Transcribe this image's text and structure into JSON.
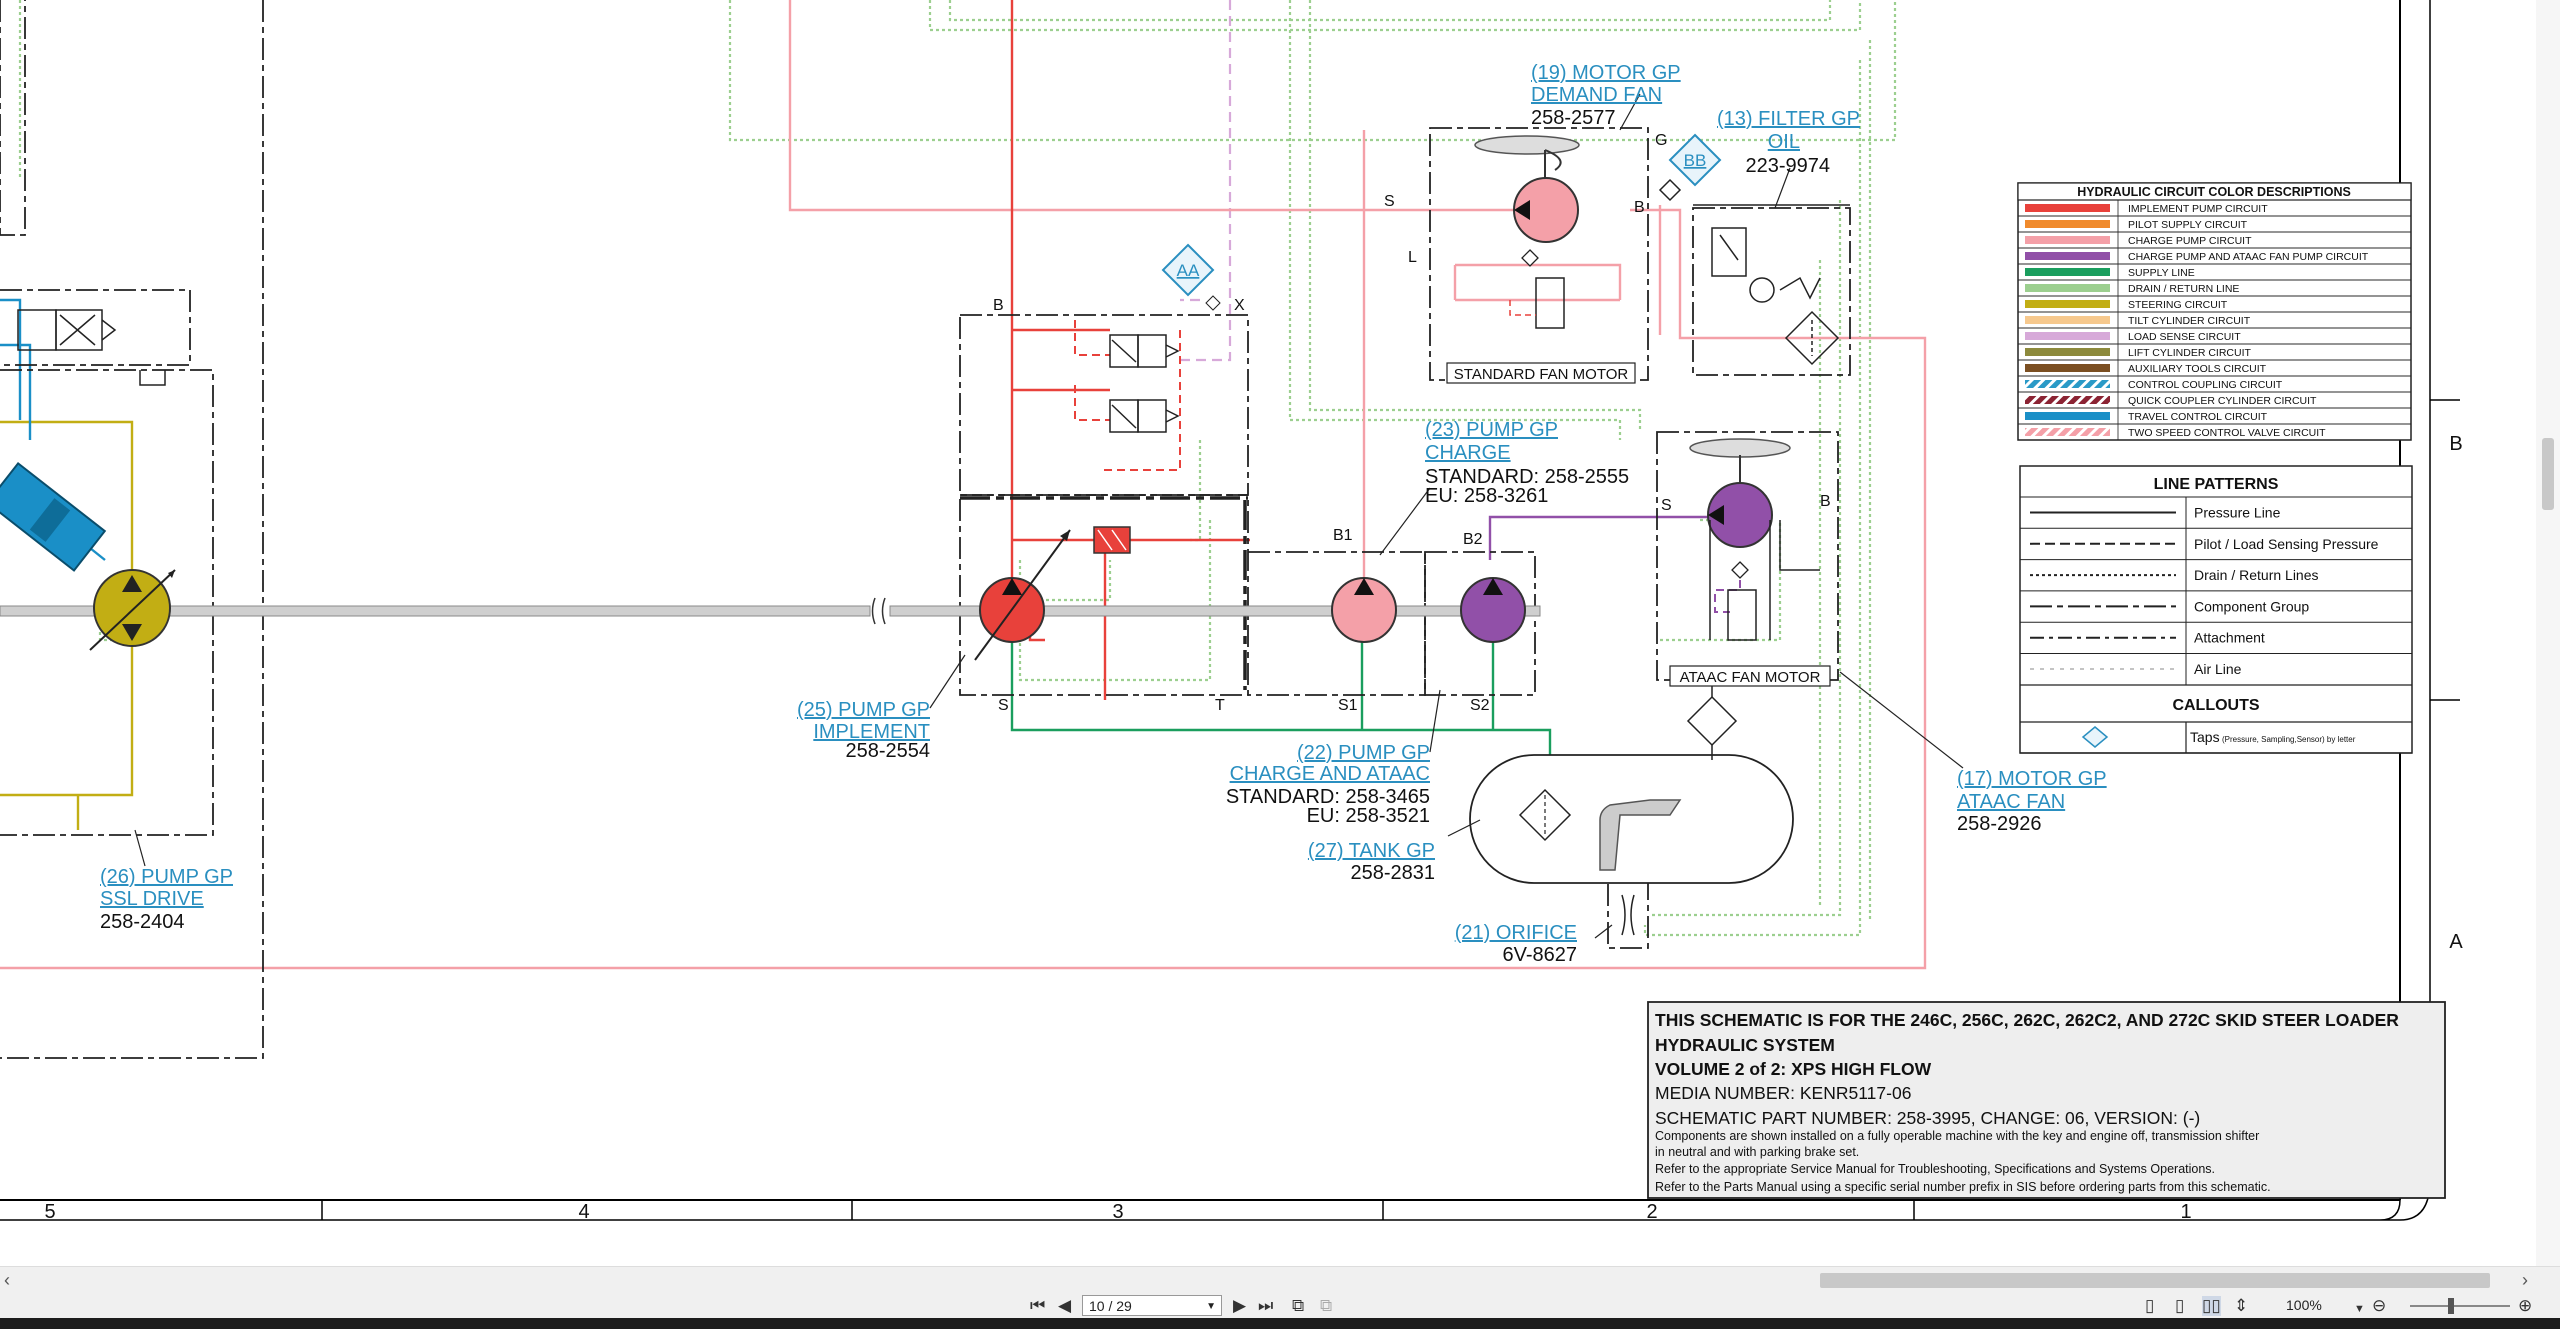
{
  "callouts": {
    "motor_demand_fan": {
      "title1": "(19) MOTOR GP",
      "title2": "DEMAND FAN",
      "part": "258-2577"
    },
    "filter_oil": {
      "title1": "(13) FILTER GP",
      "title2": "OIL",
      "part": "223-9974"
    },
    "pump_charge": {
      "title1": "(23) PUMP GP",
      "title2": "CHARGE",
      "part1": "STANDARD: 258-2555",
      "part2": "EU: 258-3261"
    },
    "pump_implement": {
      "title1": "(25) PUMP GP",
      "title2": "IMPLEMENT",
      "part": "258-2554"
    },
    "pump_charge_ataac": {
      "title1": "(22) PUMP GP",
      "title2": "CHARGE AND ATAAC",
      "part1": "STANDARD: 258-3465",
      "part2": "EU: 258-3521"
    },
    "tank": {
      "title1": "(27) TANK GP",
      "part": "258-2831"
    },
    "orifice": {
      "title1": "(21) ORIFICE",
      "part": "6V-8627"
    },
    "pump_ssl": {
      "title1": "(26) PUMP GP",
      "title2": "SSL DRIVE",
      "part": "258-2404"
    },
    "motor_ataac": {
      "title1": "(17) MOTOR GP",
      "title2": "ATAAC FAN",
      "part": "258-2926"
    }
  },
  "component_labels": {
    "standard_fan_motor": "STANDARD FAN MOTOR",
    "ataac_fan_motor": "ATAAC FAN MOTOR",
    "tap_aa": "AA",
    "tap_bb": "BB",
    "ports": {
      "s_fan": "S",
      "b_fan": "B",
      "l_fan": "L",
      "g": "G",
      "b_valve": "B",
      "x": "X",
      "b1": "B1",
      "b2": "B2",
      "s_pump": "S",
      "t": "T",
      "s1": "S1",
      "s2": "S2",
      "s_ataac": "S",
      "b_ataac": "B"
    }
  },
  "color_legend": {
    "title": "HYDRAULIC CIRCUIT COLOR DESCRIPTIONS",
    "items": [
      {
        "label": "IMPLEMENT PUMP CIRCUIT",
        "color": "#e8413b"
      },
      {
        "label": "PILOT SUPPLY CIRCUIT",
        "color": "#f08a2c"
      },
      {
        "label": "CHARGE PUMP CIRCUIT",
        "color": "#f4a0a8"
      },
      {
        "label": "CHARGE PUMP AND ATAAC FAN PUMP CIRCUIT",
        "color": "#9150a8"
      },
      {
        "label": "SUPPLY LINE",
        "color": "#1a9e5e"
      },
      {
        "label": "DRAIN / RETURN LINE",
        "color": "#9ccf8f"
      },
      {
        "label": "STEERING CIRCUIT",
        "color": "#c2ae14"
      },
      {
        "label": "TILT CYLINDER CIRCUIT",
        "color": "#f7c98e"
      },
      {
        "label": "LOAD SENSE CIRCUIT",
        "color": "#d7a9d9"
      },
      {
        "label": "LIFT CYLINDER CIRCUIT",
        "color": "#8d8a3c"
      },
      {
        "label": "AUXILIARY TOOLS CIRCUIT",
        "color": "#7b4f22"
      },
      {
        "label": "CONTROL COUPLING CIRCUIT",
        "color": "#2a9ac7",
        "hatch": "#ffffff"
      },
      {
        "label": "QUICK COUPLER CYLINDER CIRCUIT",
        "color": "#8b2333",
        "hatch": "#ffffff"
      },
      {
        "label": "TRAVEL CONTROL CIRCUIT",
        "color": "#1a8fc7"
      },
      {
        "label": "TWO SPEED CONTROL VALVE CIRCUIT",
        "color": "#f4a0a8",
        "hatch": "#ffffff"
      }
    ]
  },
  "line_patterns": {
    "title": "LINE PATTERNS",
    "items": [
      {
        "label": "Pressure Line",
        "dash": ""
      },
      {
        "label": "Pilot / Load Sensing Pressure",
        "dash": "10 5"
      },
      {
        "label": "Drain / Return Lines",
        "dash": "3 3"
      },
      {
        "label": "Component Group",
        "dash": "22 5 6 5"
      },
      {
        "label": "Attachment",
        "dash": "14 5 4 5"
      },
      {
        "label": "Air Line",
        "dash": "4 6"
      }
    ],
    "callouts_title": "CALLOUTS",
    "taps_label": "Taps",
    "taps_note": "(Pressure, Sampling,Sensor) by letter"
  },
  "title_block": {
    "line1": "THIS SCHEMATIC IS FOR THE 246C, 256C, 262C, 262C2, AND 272C SKID STEER LOADER",
    "line2": "HYDRAULIC SYSTEM",
    "line3": "VOLUME 2 of 2: XPS HIGH FLOW",
    "line4": "MEDIA NUMBER: KENR5117-06",
    "line5": "SCHEMATIC PART NUMBER: 258-3995, CHANGE: 06, VERSION: (-)",
    "note1": "Components are shown installed on a fully operable machine with the key and engine off, transmission shifter",
    "note2": "in neutral and with parking brake set.",
    "note3": "Refer to the appropriate Service Manual for Troubleshooting, Specifications and Systems Operations.",
    "note4": "Refer to the Parts Manual using a specific serial number prefix in SIS before ordering parts from this schematic."
  },
  "grid": {
    "columns": [
      "5",
      "4",
      "3",
      "2",
      "1"
    ],
    "rows": [
      "B",
      "A"
    ]
  },
  "toolbar": {
    "page_display": "10 / 29",
    "zoom": "100%"
  },
  "colors": {
    "implement": "#e8413b",
    "charge": "#f4a0a8",
    "ataac": "#9150a8",
    "supply": "#1a9e5e",
    "drain": "#9ccf8f",
    "steering": "#c2ae14",
    "travel": "#1a8fc7",
    "load_sense": "#d7a9d9",
    "shaft": "#c8c8c8"
  }
}
